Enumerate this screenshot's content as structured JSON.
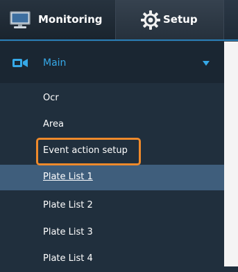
{
  "nav": {
    "monitoring_label": "Monitoring",
    "setup_label": "Setup",
    "accent_color": "#2a7fb8"
  },
  "sidebar": {
    "group": {
      "label": "Main",
      "icon": "camera-icon",
      "expanded": true,
      "color": "#36a9e8"
    },
    "items": [
      {
        "label": "Ocr"
      },
      {
        "label": "Area"
      },
      {
        "label": "Event action setup",
        "highlighted": true
      },
      {
        "label": "Plate List 1",
        "active": true
      },
      {
        "label": "Plate List 2"
      },
      {
        "label": "Plate List 3"
      },
      {
        "label": "Plate List 4"
      }
    ],
    "highlight_color": "#ef8a2b",
    "active_color": "#3f5e7c"
  }
}
